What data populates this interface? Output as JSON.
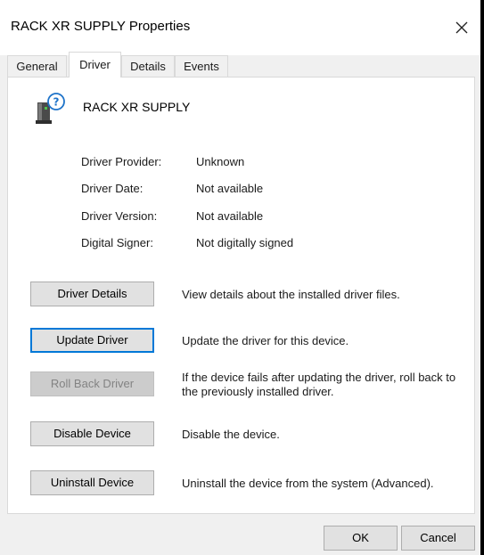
{
  "window": {
    "title": "RACK XR SUPPLY Properties",
    "close_glyph": "✕"
  },
  "tabs": [
    {
      "label": "General",
      "active": false
    },
    {
      "label": "Driver",
      "active": true
    },
    {
      "label": "Details",
      "active": false
    },
    {
      "label": "Events",
      "active": false
    }
  ],
  "device": {
    "name": "RACK XR SUPPLY",
    "icon": "unknown-device-icon"
  },
  "driver_info": [
    {
      "label": "Driver Provider:",
      "value": "Unknown"
    },
    {
      "label": "Driver Date:",
      "value": "Not available"
    },
    {
      "label": "Driver Version:",
      "value": "Not available"
    },
    {
      "label": "Digital Signer:",
      "value": "Not digitally signed"
    }
  ],
  "actions": [
    {
      "label": "Driver Details",
      "description": "View details about the installed driver files.",
      "enabled": true
    },
    {
      "label": "Update Driver",
      "description": "Update the driver for this device.",
      "enabled": true,
      "focused": true
    },
    {
      "label": "Roll Back Driver",
      "description": "If the device fails after updating the driver, roll back to the previously installed driver.",
      "enabled": false
    },
    {
      "label": "Disable Device",
      "description": "Disable the device.",
      "enabled": true
    },
    {
      "label": "Uninstall Device",
      "description": "Uninstall the device from the system (Advanced).",
      "enabled": true
    }
  ],
  "footer": {
    "ok_label": "OK",
    "cancel_label": "Cancel"
  },
  "colors": {
    "focus_border": "#0078d7",
    "help_icon": "#1e73c9",
    "dialog_bg": "#f0f0f0"
  }
}
